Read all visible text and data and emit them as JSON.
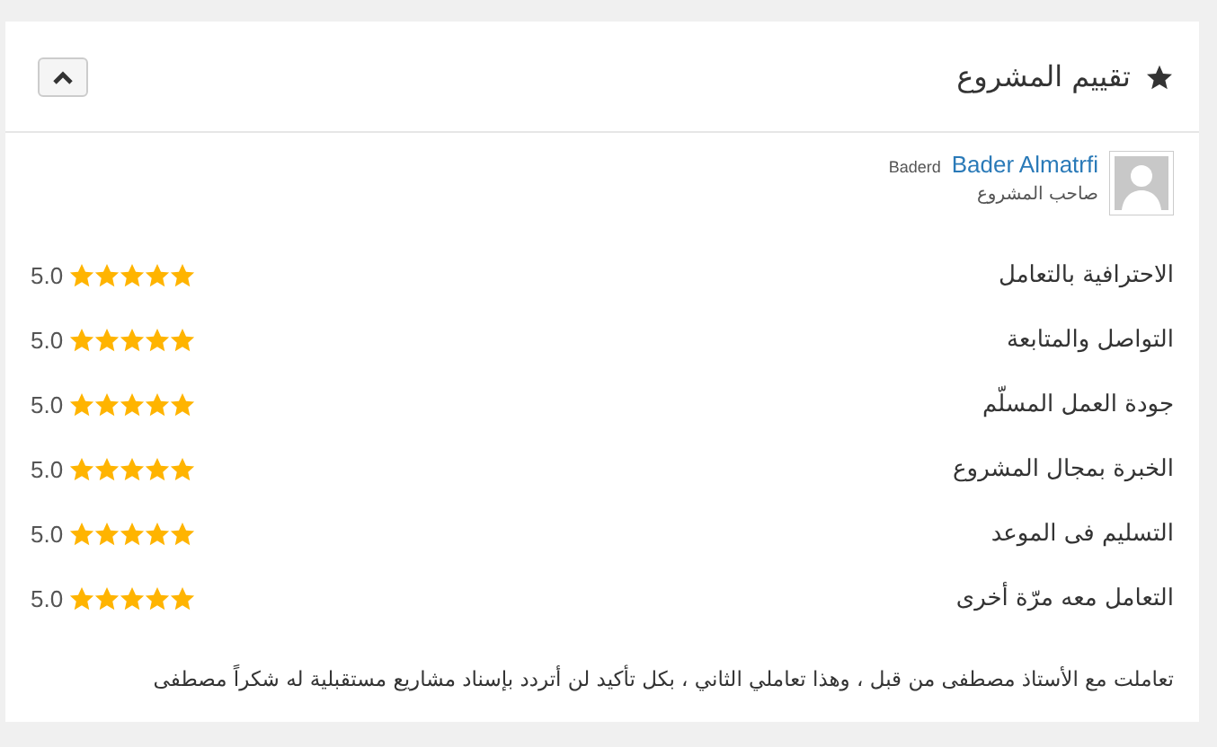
{
  "panel": {
    "title": "تقييم المشروع"
  },
  "reviewer": {
    "name": "Bader Almatrfi",
    "username": "Baderd",
    "role": "صاحب المشروع"
  },
  "ratings": [
    {
      "label": "الاحترافية بالتعامل",
      "stars": 5,
      "score": "5.0"
    },
    {
      "label": "التواصل والمتابعة",
      "stars": 5,
      "score": "5.0"
    },
    {
      "label": "جودة العمل المسلّم",
      "stars": 5,
      "score": "5.0"
    },
    {
      "label": "الخبرة بمجال المشروع",
      "stars": 5,
      "score": "5.0"
    },
    {
      "label": "التسليم فى الموعد",
      "stars": 5,
      "score": "5.0"
    },
    {
      "label": "التعامل معه مرّة أخرى",
      "stars": 5,
      "score": "5.0"
    }
  ],
  "comment": "تعاملت مع الأستاذ مصطفى من قبل ، وهذا تعاملي الثاني ، بكل تأكيد لن أتردد بإسناد مشاريع مستقبلية له شكراً مصطفى"
}
